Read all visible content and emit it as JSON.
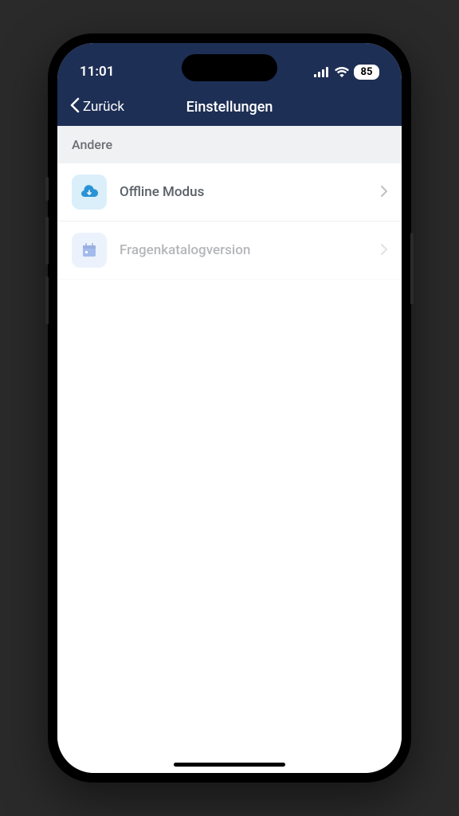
{
  "statusBar": {
    "time": "11:01",
    "battery": "85"
  },
  "navBar": {
    "backLabel": "Zurück",
    "title": "Einstellungen"
  },
  "section": {
    "header": "Andere"
  },
  "items": [
    {
      "label": "Offline Modus"
    },
    {
      "label": "Fragenkatalogversion"
    }
  ]
}
